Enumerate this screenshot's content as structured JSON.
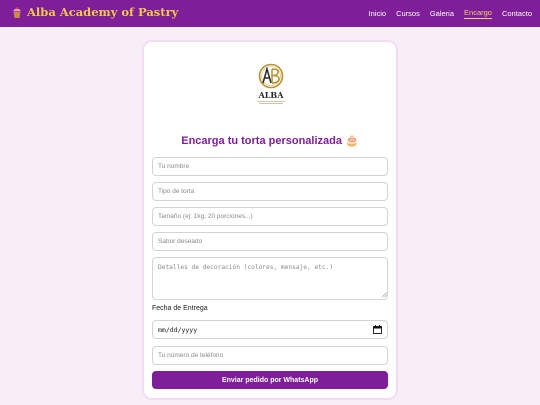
{
  "header": {
    "brand": "Alba Academy of Pastry",
    "nav": [
      {
        "label": "Inicio",
        "active": false
      },
      {
        "label": "Cursos",
        "active": false
      },
      {
        "label": "Galeria",
        "active": false
      },
      {
        "label": "Encargo",
        "active": true
      },
      {
        "label": "Contacto",
        "active": false
      }
    ]
  },
  "colors": {
    "primary": "#7e1e98",
    "accent": "#f2c94c",
    "background": "#f8eef8"
  },
  "logo": {
    "text": "ALBA",
    "icon": "alba-monogram-logo"
  },
  "form": {
    "title": "Encarga tu torta personalizada 🎂",
    "fields": {
      "name": {
        "placeholder": "Tu nombre",
        "value": ""
      },
      "cake_type": {
        "placeholder": "Tipo de torta",
        "value": ""
      },
      "size": {
        "placeholder": "Tamaño (ej: 1kg, 20 porciones...)",
        "value": ""
      },
      "flavor": {
        "placeholder": "Sabor deseado",
        "value": ""
      },
      "decoration": {
        "placeholder": "Detalles de decoración (colores, mensaje, etc.)",
        "value": ""
      },
      "phone": {
        "placeholder": "Tu número de teléfono",
        "value": ""
      }
    },
    "date_label": "Fecha de Entrega",
    "date_placeholder": "mm/dd/yyyy",
    "submit_label": "Enviar pedido por WhatsApp"
  }
}
